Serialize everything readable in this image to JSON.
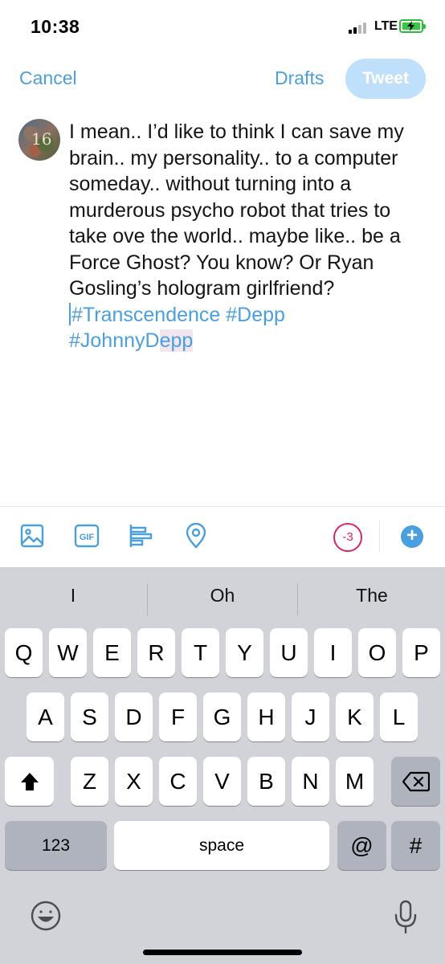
{
  "status": {
    "time": "10:38",
    "network": "LTE"
  },
  "topbar": {
    "cancel": "Cancel",
    "drafts": "Drafts",
    "tweet": "Tweet"
  },
  "avatar": {
    "badge": "16"
  },
  "composer": {
    "text": "I mean.. I’d like to think I can save my brain.. my personality.. to a computer someday.. without turning into a murderous psycho robot that tries to take ove the world.. maybe like.. be a Force Ghost? You know? Or Ryan Gosling’s hologram girlfriend?",
    "hashtag1": "#Transcendence",
    "hashtag2": "#Depp",
    "hashtag3_part1": "#JohnnyD",
    "hashtag3_part2": "epp"
  },
  "toolbar": {
    "icons": [
      "image-icon",
      "gif-icon",
      "poll-icon",
      "location-icon"
    ],
    "gif_label": "GIF",
    "char_count": "-3",
    "add": "+"
  },
  "keyboard": {
    "suggestions": [
      "I",
      "Oh",
      "The"
    ],
    "row1": [
      "Q",
      "W",
      "E",
      "R",
      "T",
      "Y",
      "U",
      "I",
      "O",
      "P"
    ],
    "row2": [
      "A",
      "S",
      "D",
      "F",
      "G",
      "H",
      "J",
      "K",
      "L"
    ],
    "row3": [
      "Z",
      "X",
      "C",
      "V",
      "B",
      "N",
      "M"
    ],
    "numbers": "123",
    "space": "space",
    "at": "@",
    "hash": "#"
  },
  "colors": {
    "accent": "#4a9fe0",
    "tweet_disabled": "#bfe0fb",
    "counter": "#e0245e",
    "keyboard_bg": "#d1d3d9"
  }
}
